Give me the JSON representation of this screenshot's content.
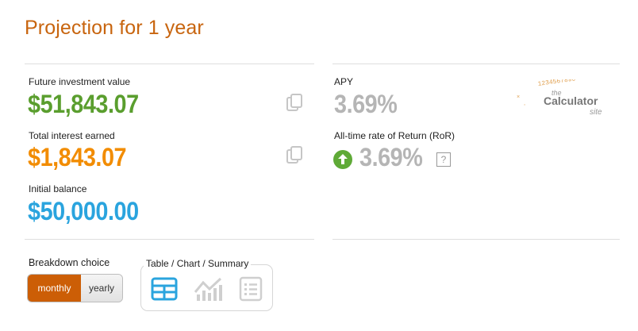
{
  "page": {
    "title": "Projection for 1 year"
  },
  "results": {
    "future_value_label": "Future investment value",
    "future_value": "$51,843.07",
    "interest_label": "Total interest earned",
    "interest": "$1,843.07",
    "initial_label": "Initial balance",
    "initial": "$50,000.00",
    "apy_label": "APY",
    "apy": "3.69%",
    "ror_label": "All-time rate of Return (RoR)",
    "ror": "3.69%",
    "help_symbol": "?"
  },
  "logo": {
    "the": "the",
    "name": "Calculator",
    "site": "site",
    "digits": "1234567890"
  },
  "breakdown": {
    "label": "Breakdown choice",
    "options": [
      "monthly",
      "yearly"
    ],
    "selected": "monthly"
  },
  "view": {
    "label": "Table / Chart / Summary",
    "options": [
      "table-icon",
      "chart-icon",
      "summary-icon"
    ],
    "selected": "table-icon"
  },
  "colors": {
    "title": "#c8650f",
    "future_value": "#5a9e2e",
    "interest": "#f28c00",
    "initial": "#2aa4de",
    "muted": "#b5b5b5",
    "toggle_active": "#cc5e06",
    "icon_active": "#2aa4de"
  }
}
